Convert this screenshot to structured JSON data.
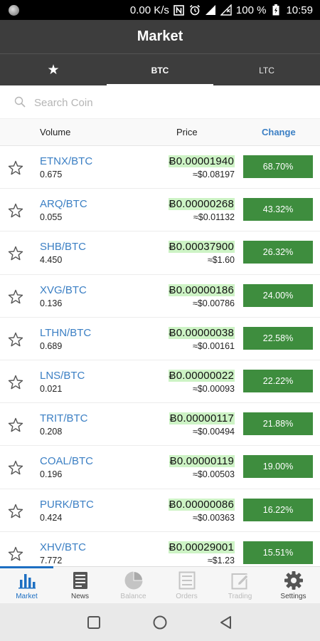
{
  "status_bar": {
    "net_speed": "0.00 K/s",
    "battery": "100 %",
    "time": "10:59",
    "icons": [
      "nfc-icon",
      "alarm-icon",
      "signal-icon",
      "no-sim-icon",
      "battery-charging-icon"
    ]
  },
  "header": {
    "title": "Market"
  },
  "tabs": [
    {
      "label": "★",
      "icon": "star-icon",
      "active": false
    },
    {
      "label": "BTC",
      "active": true
    },
    {
      "label": "LTC",
      "active": false
    }
  ],
  "search": {
    "placeholder": "Search Coin",
    "value": ""
  },
  "columns": {
    "volume": "Volume",
    "price": "Price",
    "change": "Change"
  },
  "colors": {
    "header_bg": "#3d3d3d",
    "link_blue": "#3b7fc4",
    "change_green": "#3e8d3e",
    "price_highlight": "#cdf3c5",
    "nav_active": "#1d6fc2"
  },
  "rows": [
    {
      "pair": "ETNX/BTC",
      "volume": "0.675",
      "price": "Ƀ0.00001940",
      "usd": "≈$0.08197",
      "change": "68.70%"
    },
    {
      "pair": "ARQ/BTC",
      "volume": "0.055",
      "price": "Ƀ0.00000268",
      "usd": "≈$0.01132",
      "change": "43.32%"
    },
    {
      "pair": "SHB/BTC",
      "volume": "4.450",
      "price": "Ƀ0.00037900",
      "usd": "≈$1.60",
      "change": "26.32%"
    },
    {
      "pair": "XVG/BTC",
      "volume": "0.136",
      "price": "Ƀ0.00000186",
      "usd": "≈$0.00786",
      "change": "24.00%"
    },
    {
      "pair": "LTHN/BTC",
      "volume": "0.689",
      "price": "Ƀ0.00000038",
      "usd": "≈$0.00161",
      "change": "22.58%"
    },
    {
      "pair": "LNS/BTC",
      "volume": "0.021",
      "price": "Ƀ0.00000022",
      "usd": "≈$0.00093",
      "change": "22.22%"
    },
    {
      "pair": "TRIT/BTC",
      "volume": "0.208",
      "price": "Ƀ0.00000117",
      "usd": "≈$0.00494",
      "change": "21.88%"
    },
    {
      "pair": "COAL/BTC",
      "volume": "0.196",
      "price": "Ƀ0.00000119",
      "usd": "≈$0.00503",
      "change": "19.00%"
    },
    {
      "pair": "PURK/BTC",
      "volume": "0.424",
      "price": "Ƀ0.00000086",
      "usd": "≈$0.00363",
      "change": "16.22%"
    },
    {
      "pair": "XHV/BTC",
      "volume": "7.772",
      "price": "Ƀ0.00029001",
      "usd": "≈$1.23",
      "change": "15.51%"
    }
  ],
  "bottom_nav": [
    {
      "label": "Market",
      "icon": "bar-chart-icon",
      "state": "active"
    },
    {
      "label": "News",
      "icon": "newspaper-icon",
      "state": "normal"
    },
    {
      "label": "Balance",
      "icon": "pie-chart-icon",
      "state": "disabled"
    },
    {
      "label": "Orders",
      "icon": "list-icon",
      "state": "disabled"
    },
    {
      "label": "Trading",
      "icon": "edit-icon",
      "state": "disabled"
    },
    {
      "label": "Settings",
      "icon": "gear-icon",
      "state": "normal"
    }
  ],
  "android_nav": [
    "recents-square-icon",
    "home-circle-icon",
    "back-triangle-icon"
  ]
}
